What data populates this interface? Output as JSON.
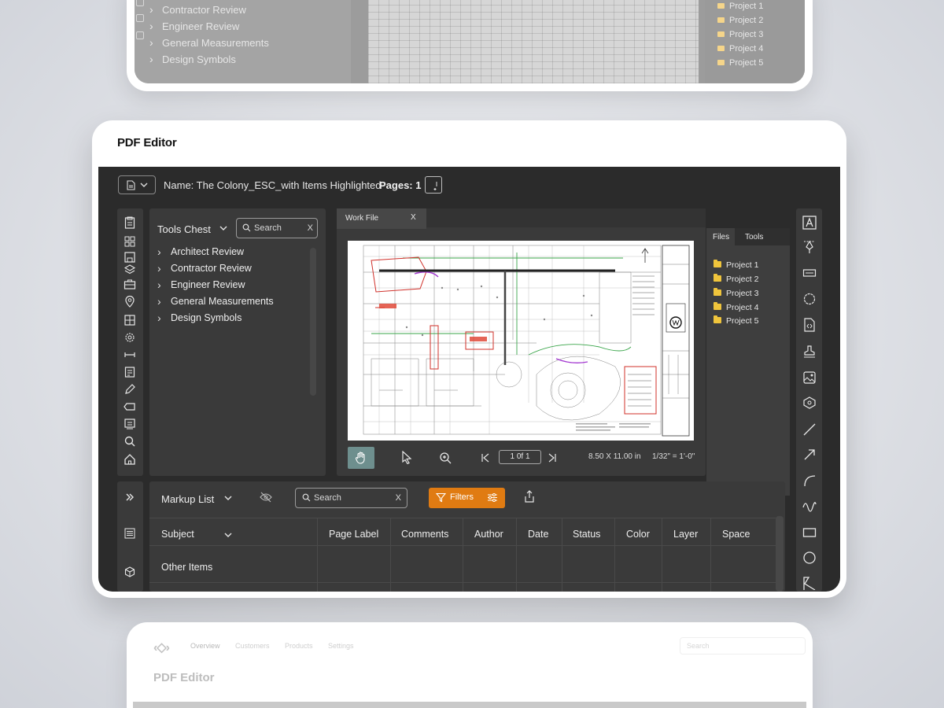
{
  "ghost_top": {
    "tree_items": [
      "Contractor Review",
      "Engineer Review",
      "General Measurements",
      "Design Symbols"
    ],
    "projects": [
      "Project 1",
      "Project 2",
      "Project 3",
      "Project 4",
      "Project 5"
    ]
  },
  "card": {
    "title": "PDF Editor"
  },
  "topbar": {
    "doc_name": "Name: The Colony_ESC_with Items Highlighted",
    "pages": "Pages: 1"
  },
  "tools_chest": {
    "title": "Tools Chest",
    "search_placeholder": "Search",
    "clear": "X",
    "items": [
      "Architect Review",
      "Contractor Review",
      "Engineer Review",
      "General Measurements",
      "Design Symbols"
    ]
  },
  "viewer": {
    "tab_label": "Work File",
    "tab_close": "X",
    "page_indicator": "1 0f 1",
    "page_size": "8.50 X 11.00 in",
    "scale": "1/32\" = 1'-0\""
  },
  "files_panel": {
    "tabs": [
      "Files",
      "Tools"
    ],
    "projects": [
      "Project 1",
      "Project 2",
      "Project 3",
      "Project 4",
      "Project 5"
    ],
    "folder_color": "#f0c53c"
  },
  "markup_list": {
    "title": "Markup List",
    "search_placeholder": "Search",
    "clear": "X",
    "filters_label": "Filters",
    "columns": [
      "Subject",
      "Page Label",
      "Comments",
      "Author",
      "Date",
      "Status",
      "Color",
      "Layer",
      "Space"
    ],
    "rows": [
      "Other Items"
    ]
  },
  "ghost_bottom": {
    "logo": "‹◇›",
    "nav": [
      "Overview",
      "Customers",
      "Products",
      "Settings"
    ],
    "search_placeholder": "Search",
    "title": "PDF Editor"
  },
  "colors": {
    "accent": "#e07b12",
    "app_bg": "#2b2b2b",
    "panel_bg": "#3a3a3a",
    "hand_active": "#6e8f8e"
  }
}
